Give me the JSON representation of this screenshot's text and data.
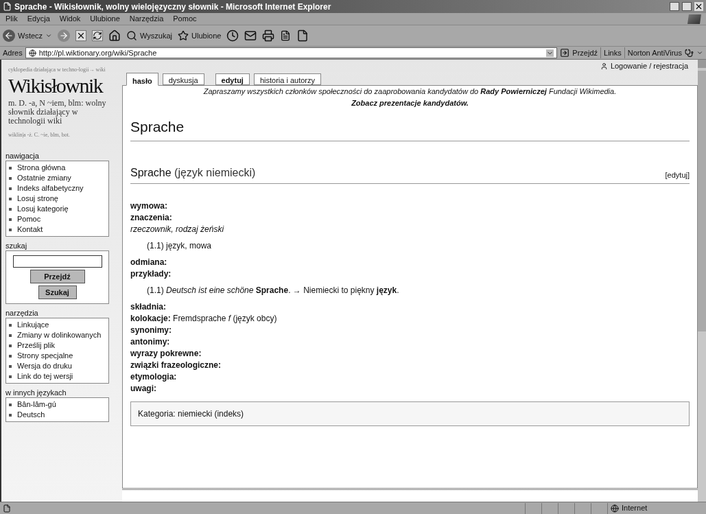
{
  "window": {
    "title": "Sprache - Wikisłownik, wolny wielojęzyczny słownik - Microsoft Internet Explorer"
  },
  "menu": [
    "Plik",
    "Edycja",
    "Widok",
    "Ulubione",
    "Narzędzia",
    "Pomoc"
  ],
  "toolbar": {
    "back": "Wstecz",
    "search": "Wyszukaj",
    "favorites": "Ulubione"
  },
  "address_bar": {
    "label": "Adres",
    "value": "http://pl.wiktionary.org/wiki/Sprache",
    "go": "Przejdź",
    "links": "Links",
    "norton": "Norton AntiVirus"
  },
  "logo": {
    "tagline": "cyklopedia działająca w techno-logii→ wiki",
    "title": "Wikisłownik",
    "definition": "m. D. -a, N ~iem, blm: wolny słownik działający w technologii wiki",
    "footnote": "wiklin|a -ż. C. ~ie, blm, bot."
  },
  "login": "Logowanie / rejestracja",
  "sidebar": [
    {
      "kind": "links",
      "title": "nawigacja",
      "items": [
        "Strona główna",
        "Ostatnie zmiany",
        "Indeks alfabetyczny",
        "Losuj stronę",
        "Losuj kategorię",
        "Pomoc",
        "Kontakt"
      ]
    },
    {
      "kind": "search",
      "title": "szukaj",
      "buttons": [
        "Przejdź",
        "Szukaj"
      ]
    },
    {
      "kind": "links",
      "title": "narzędzia",
      "items": [
        "Linkujące",
        "Zmiany w dolinkowanych",
        "Prześlij plik",
        "Strony specjalne",
        "Wersja do druku",
        "Link do tej wersji"
      ]
    },
    {
      "kind": "links",
      "title": "w innych językach",
      "items": [
        "Bân-lâm-gú",
        "Deutsch"
      ]
    }
  ],
  "tabs": [
    {
      "label": "hasło",
      "selected": true,
      "bold": true
    },
    {
      "label": "dyskusja",
      "selected": false,
      "bold": false
    },
    {
      "label": "edytuj",
      "selected": false,
      "bold": true
    },
    {
      "label": "historia i autorzy",
      "selected": false,
      "bold": false
    }
  ],
  "notice": [
    "Zapraszamy wszystkich członków społeczności do zaaprobowania kandydatów do **Rady Powierniczej** Fundacji Wikimedia.",
    "**Zobacz prezentacje kandydatów.**"
  ],
  "page_title": "Sprache",
  "section": {
    "heading": "Sprache",
    "language": "(język niemiecki)",
    "edit": "[edytuj]"
  },
  "entries": [
    {
      "kind": "label",
      "text": "wymowa:"
    },
    {
      "kind": "label",
      "text": "znaczenia:"
    },
    {
      "kind": "note",
      "text": "rzeczownik, rodzaj żeński"
    },
    {
      "kind": "indent",
      "text": "(1.1) język, mowa"
    },
    {
      "kind": "label",
      "text": "odmiana:"
    },
    {
      "kind": "label",
      "text": "przykłady:"
    },
    {
      "kind": "indent",
      "text": "(1.1) *Deutsch ist eine schöne* **Sprache**. → Niemiecki to piękny **język**."
    },
    {
      "kind": "label",
      "text": "składnia:"
    },
    {
      "kind": "label",
      "text": "kolokacje:",
      "value": "Fremdsprache *f* (język obcy)"
    },
    {
      "kind": "label",
      "text": "synonimy:"
    },
    {
      "kind": "label",
      "text": "antonimy:"
    },
    {
      "kind": "label",
      "text": "wyrazy pokrewne:"
    },
    {
      "kind": "label",
      "text": "związki frazeologiczne:"
    },
    {
      "kind": "label",
      "text": "etymologia:"
    },
    {
      "kind": "label",
      "text": "uwagi:"
    }
  ],
  "category": "Kategoria: niemiecki (indeks)",
  "status_bar": {
    "zone": "Internet"
  }
}
